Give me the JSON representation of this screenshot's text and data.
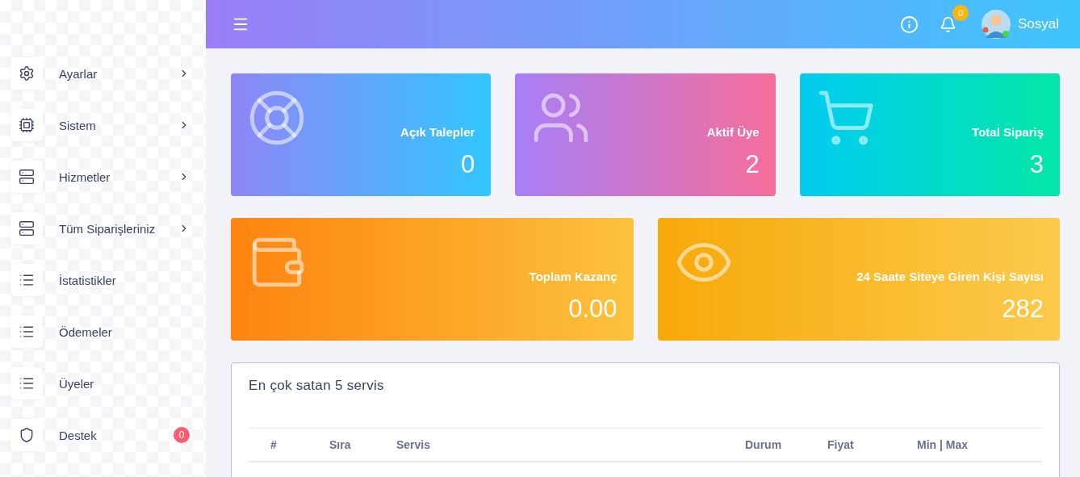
{
  "header": {
    "notifications": "0",
    "user": "Sosyal"
  },
  "sidebar": {
    "items": [
      {
        "label": "Ayarlar",
        "expandable": true
      },
      {
        "label": "Sistem",
        "expandable": true
      },
      {
        "label": "Hizmetler",
        "expandable": true
      },
      {
        "label": "Tüm Siparişleriniz",
        "expandable": true
      },
      {
        "label": "İstatistikler",
        "expandable": false
      },
      {
        "label": "Ödemeler",
        "expandable": false
      },
      {
        "label": "Üyeler",
        "expandable": false
      },
      {
        "label": "Destek",
        "expandable": false,
        "badge": "0"
      }
    ]
  },
  "stats": [
    {
      "title": "Açık Talepler",
      "value": "0"
    },
    {
      "title": "Aktif Üye",
      "value": "2"
    },
    {
      "title": "Total Sipariş",
      "value": "3"
    },
    {
      "title": "Toplam Kazanç",
      "value": "0.00"
    },
    {
      "title": "24 Saate Siteye Giren Kişi Sayısı",
      "value": "282"
    }
  ],
  "table": {
    "title": "En çok satan 5 servis",
    "columns": [
      "#",
      "Sıra",
      "Servis",
      "Durum",
      "Fiyat",
      "Min | Max"
    ]
  }
}
